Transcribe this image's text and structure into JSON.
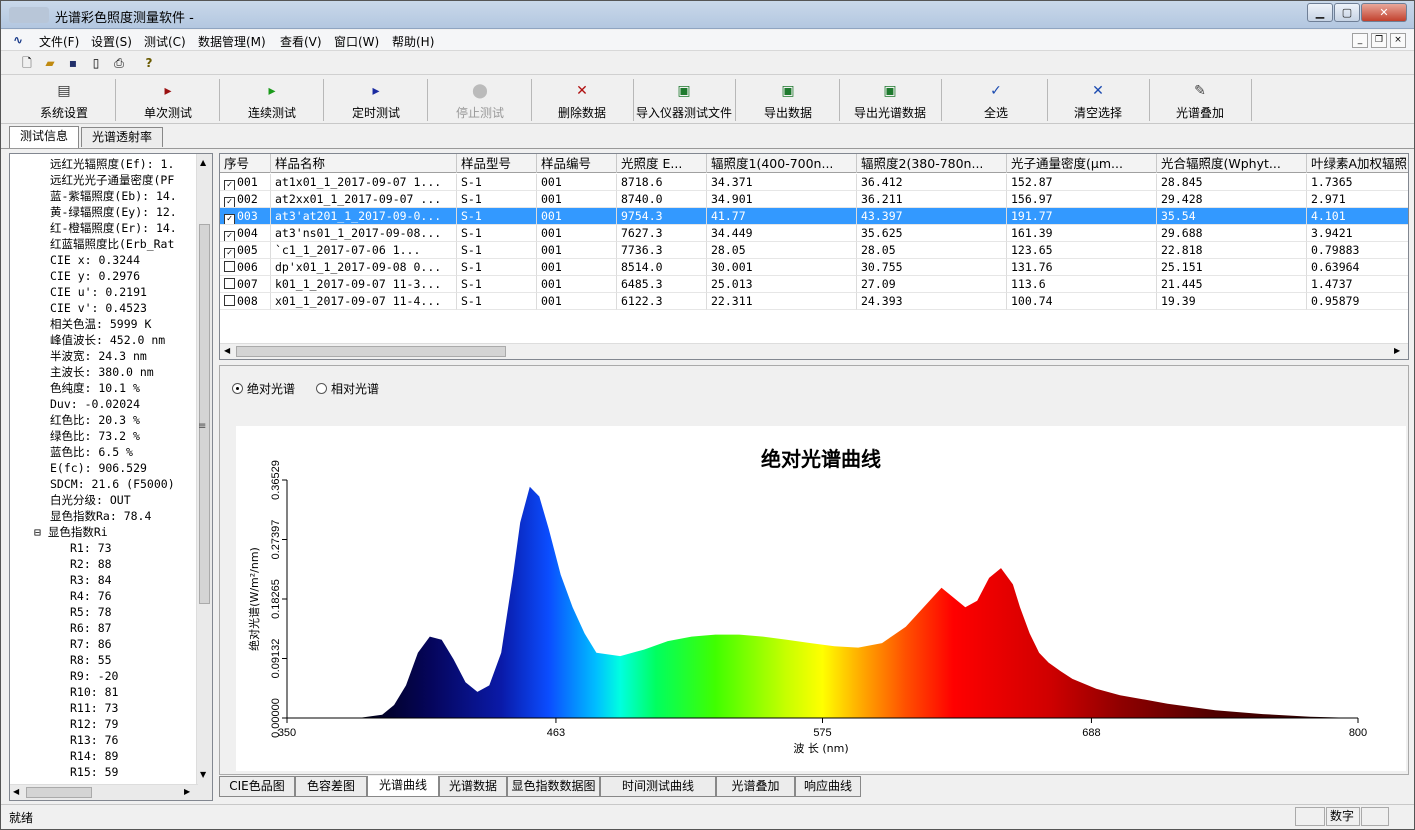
{
  "window": {
    "title": "光谱彩色照度测量软件 - "
  },
  "menu": [
    "文件(F)",
    "设置(S)",
    "测试(C)",
    "数据管理(M)",
    "查看(V)",
    "窗口(W)",
    "帮助(H)"
  ],
  "toolbar_buttons": [
    {
      "label": "系统设置",
      "icon": "settings-icon",
      "glyph": "▤",
      "color": "#333333",
      "disabled": false
    },
    {
      "label": "单次测试",
      "icon": "play-red-icon",
      "glyph": "▸",
      "color": "#9a1010",
      "disabled": false
    },
    {
      "label": "连续测试",
      "icon": "play-green-icon",
      "glyph": "▸",
      "color": "#1a9a1a",
      "disabled": false
    },
    {
      "label": "定时测试",
      "icon": "play-blue-icon",
      "glyph": "▸",
      "color": "#1a2aa0",
      "disabled": false
    },
    {
      "label": "停止测试",
      "icon": "stop-icon",
      "glyph": "⬤",
      "color": "#bbbbbb",
      "disabled": true
    },
    {
      "label": "删除数据",
      "icon": "delete-icon",
      "glyph": "✕",
      "color": "#b01010",
      "disabled": false
    },
    {
      "label": "导入仪器测试文件",
      "icon": "excel-icon",
      "glyph": "▣",
      "color": "#1e7a2e",
      "disabled": false
    },
    {
      "label": "导出数据",
      "icon": "excel-icon",
      "glyph": "▣",
      "color": "#1e7a2e",
      "disabled": false
    },
    {
      "label": "导出光谱数据",
      "icon": "excel-icon",
      "glyph": "▣",
      "color": "#1e7a2e",
      "disabled": false
    },
    {
      "label": "全选",
      "icon": "check-icon",
      "glyph": "✓",
      "color": "#1a4ab0",
      "disabled": false
    },
    {
      "label": "清空选择",
      "icon": "clear-icon",
      "glyph": "✕",
      "color": "#1a4ab0",
      "disabled": false
    },
    {
      "label": "光谱叠加",
      "icon": "overlay-icon",
      "glyph": "✎",
      "color": "#444444",
      "disabled": false
    }
  ],
  "left_tabs": [
    "测试信息",
    "光谱透射率"
  ],
  "tree_items": [
    {
      "text": "远红光辐照度(Ef):  1.",
      "level": 1
    },
    {
      "text": "远红光光子通量密度(PF",
      "level": 1
    },
    {
      "text": "蓝-紫辐照度(Eb):  14.",
      "level": 1
    },
    {
      "text": "黄-绿辐照度(Ey):  12.",
      "level": 1
    },
    {
      "text": "红-橙辐照度(Er):  14.",
      "level": 1
    },
    {
      "text": "红蓝辐照度比(Erb_Rat",
      "level": 1
    },
    {
      "text": "CIE x: 0.3244",
      "level": 1
    },
    {
      "text": "CIE y: 0.2976",
      "level": 1
    },
    {
      "text": "CIE u': 0.2191",
      "level": 1
    },
    {
      "text": "CIE v': 0.4523",
      "level": 1
    },
    {
      "text": "相关色温: 5999 K",
      "level": 1
    },
    {
      "text": "峰值波长: 452.0 nm",
      "level": 1
    },
    {
      "text": "半波宽: 24.3 nm",
      "level": 1
    },
    {
      "text": "主波长: 380.0 nm",
      "level": 1
    },
    {
      "text": "色纯度: 10.1 %",
      "level": 1
    },
    {
      "text": "Duv: -0.02024",
      "level": 1
    },
    {
      "text": "红色比: 20.3 %",
      "level": 1
    },
    {
      "text": "绿色比: 73.2 %",
      "level": 1
    },
    {
      "text": "蓝色比: 6.5 %",
      "level": 1
    },
    {
      "text": "E(fc): 906.529",
      "level": 1
    },
    {
      "text": "SDCM: 21.6 (F5000)",
      "level": 1
    },
    {
      "text": "白光分级: OUT",
      "level": 1
    },
    {
      "text": "显色指数Ra: 78.4",
      "level": 1
    },
    {
      "text": "⊟ 显色指数Ri",
      "level": 0
    },
    {
      "text": "R1: 73",
      "level": 2
    },
    {
      "text": "R2: 88",
      "level": 2
    },
    {
      "text": "R3: 84",
      "level": 2
    },
    {
      "text": "R4: 76",
      "level": 2
    },
    {
      "text": "R5: 78",
      "level": 2
    },
    {
      "text": "R6: 87",
      "level": 2
    },
    {
      "text": "R7: 86",
      "level": 2
    },
    {
      "text": "R8: 55",
      "level": 2
    },
    {
      "text": "R9: -20",
      "level": 2
    },
    {
      "text": "R10: 81",
      "level": 2
    },
    {
      "text": "R11: 73",
      "level": 2
    },
    {
      "text": "R12: 79",
      "level": 2
    },
    {
      "text": "R13: 76",
      "level": 2
    },
    {
      "text": "R14: 89",
      "level": 2
    },
    {
      "text": "R15: 59",
      "level": 2
    }
  ],
  "table": {
    "columns": [
      "序号",
      "样品名称",
      "样品型号",
      "样品编号",
      "光照度 E...",
      "辐照度1(400-700n...",
      "辐照度2(380-780n...",
      "光子通量密度(μm...",
      "光合辐照度(Wphyt...",
      "叶绿素A加权辐照"
    ],
    "rows": [
      {
        "checked": true,
        "selected": false,
        "cells": [
          "001",
          "at1x01_1_2017-09-07 1...",
          "S-1",
          "001",
          "8718.6",
          "34.371",
          "36.412",
          "152.87",
          "28.845",
          "1.7365"
        ]
      },
      {
        "checked": true,
        "selected": false,
        "cells": [
          "002",
          "at2xx01_1_2017-09-07 ...",
          "S-1",
          "001",
          "8740.0",
          "34.901",
          "36.211",
          "156.97",
          "29.428",
          "2.971"
        ]
      },
      {
        "checked": true,
        "selected": true,
        "cells": [
          "003",
          "at3'at201_1_2017-09-0...",
          "S-1",
          "001",
          "9754.3",
          "41.77",
          "43.397",
          "191.77",
          "35.54",
          "4.101"
        ]
      },
      {
        "checked": true,
        "selected": false,
        "cells": [
          "004",
          "at3'ns01_1_2017-09-08...",
          "S-1",
          "001",
          "7627.3",
          "34.449",
          "35.625",
          "161.39",
          "29.688",
          "3.9421"
        ]
      },
      {
        "checked": true,
        "selected": false,
        "cells": [
          "005",
          "    `c1_1_2017-07-06 1...",
          "S-1",
          "001",
          "7736.3",
          "28.05",
          "28.05",
          "123.65",
          "22.818",
          "0.79883"
        ]
      },
      {
        "checked": false,
        "selected": false,
        "cells": [
          "006",
          "dp'x01_1_2017-09-08 0...",
          "S-1",
          "001",
          "8514.0",
          "30.001",
          "30.755",
          "131.76",
          "25.151",
          "0.63964"
        ]
      },
      {
        "checked": false,
        "selected": false,
        "cells": [
          "007",
          "k01_1_2017-09-07 11-3...",
          "S-1",
          "001",
          "6485.3",
          "25.013",
          "27.09",
          "113.6",
          "21.445",
          "1.4737"
        ]
      },
      {
        "checked": false,
        "selected": false,
        "cells": [
          "008",
          "x01_1_2017-09-07 11-4...",
          "S-1",
          "001",
          "6122.3",
          "22.311",
          "24.393",
          "100.74",
          "19.39",
          "0.95879"
        ]
      }
    ]
  },
  "spectrum_options": {
    "absolute": "绝对光谱",
    "relative": "相对光谱",
    "selected": "absolute"
  },
  "chart_data": {
    "type": "area",
    "title": "绝对光谱曲线",
    "xlabel": "波 长 (nm)",
    "ylabel": "绝对光谱(W/m²/nm)",
    "xlim": [
      350,
      800
    ],
    "ylim": [
      0,
      0.36529
    ],
    "x_ticks": [
      "350",
      "463",
      "575",
      "688",
      "800"
    ],
    "y_ticks": [
      "0.00000",
      "0.09132",
      "0.18265",
      "0.27397",
      "0.36529"
    ],
    "x": [
      380,
      390,
      395,
      400,
      405,
      410,
      415,
      420,
      425,
      430,
      435,
      440,
      445,
      448,
      452,
      456,
      460,
      465,
      470,
      475,
      480,
      490,
      500,
      510,
      520,
      530,
      540,
      550,
      560,
      570,
      580,
      590,
      600,
      610,
      620,
      625,
      630,
      635,
      640,
      645,
      650,
      655,
      658,
      662,
      666,
      670,
      675,
      680,
      690,
      700,
      720,
      740,
      760,
      780,
      800
    ],
    "values": [
      0.0,
      0.005,
      0.02,
      0.05,
      0.1,
      0.125,
      0.12,
      0.09,
      0.055,
      0.04,
      0.05,
      0.1,
      0.22,
      0.3,
      0.355,
      0.34,
      0.29,
      0.22,
      0.17,
      0.13,
      0.1,
      0.095,
      0.105,
      0.118,
      0.125,
      0.128,
      0.128,
      0.125,
      0.12,
      0.115,
      0.11,
      0.108,
      0.115,
      0.14,
      0.18,
      0.2,
      0.185,
      0.17,
      0.18,
      0.215,
      0.23,
      0.205,
      0.17,
      0.13,
      0.1,
      0.085,
      0.072,
      0.06,
      0.045,
      0.035,
      0.022,
      0.012,
      0.006,
      0.002,
      0.0
    ]
  },
  "bottom_tabs": [
    "CIE色品图",
    "色容差图",
    "光谱曲线",
    "光谱数据",
    "显色指数数据图",
    "时间测试曲线",
    "光谱叠加",
    "响应曲线"
  ],
  "status": {
    "left": "就绪",
    "mode": "数字"
  }
}
